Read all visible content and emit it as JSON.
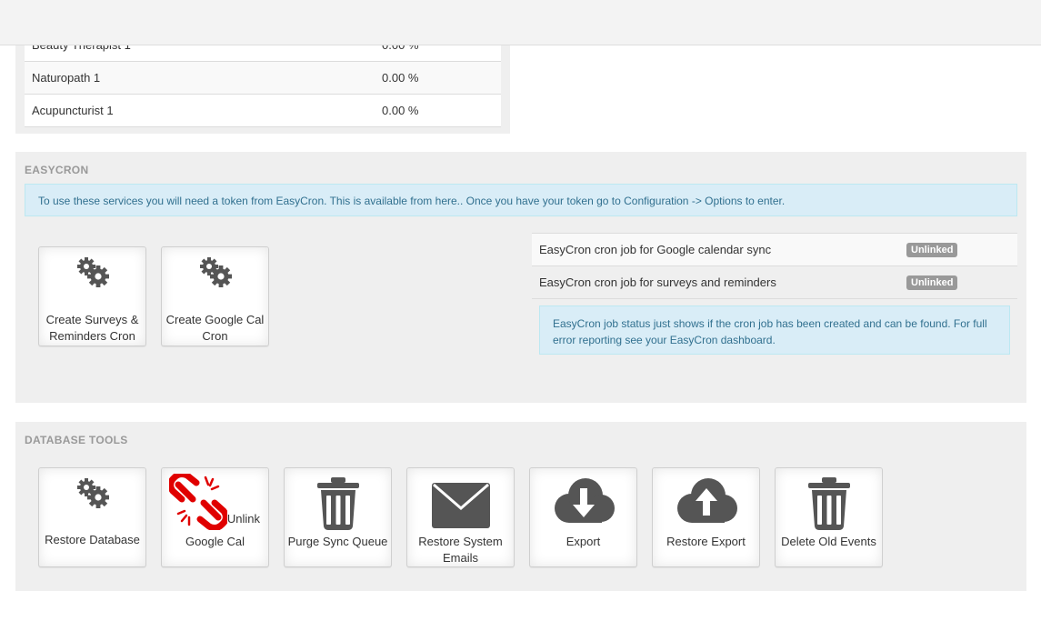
{
  "top_table": {
    "rows": [
      {
        "name": "Beauty Therapist 1",
        "value": "0.00 %"
      },
      {
        "name": "Naturopath 1",
        "value": "0.00 %"
      },
      {
        "name": "Acupuncturist 1",
        "value": "0.00 %"
      }
    ]
  },
  "easycron": {
    "title": "EASYCRON",
    "info": "To use these services you will need a token from EasyCron. This is available from here.. Once you have your token go to Configuration -> Options to enter.",
    "tiles": [
      {
        "label": "Create Surveys & Reminders Cron",
        "icon": "gears-icon"
      },
      {
        "label": "Create Google Cal Cron",
        "icon": "gears-icon"
      }
    ],
    "jobs": [
      {
        "name": "EasyCron cron job for Google calendar sync",
        "status": "Unlinked"
      },
      {
        "name": "EasyCron cron job for surveys and reminders",
        "status": "Unlinked"
      }
    ],
    "note": "EasyCron job status just shows if the cron job has been created and can be found. For full error reporting see your EasyCron dashboard."
  },
  "dbtools": {
    "title": "DATABASE TOOLS",
    "tiles": [
      {
        "label": "Restore Database",
        "icon": "gears-icon"
      },
      {
        "label": "Google Cal",
        "extra": "Unlink",
        "icon": "broken-link-icon"
      },
      {
        "label": "Purge Sync Queue",
        "icon": "trash-icon"
      },
      {
        "label": "Restore System Emails",
        "icon": "envelope-icon"
      },
      {
        "label": "Export",
        "icon": "cloud-download-icon"
      },
      {
        "label": "Restore Export",
        "icon": "cloud-upload-icon"
      },
      {
        "label": "Delete Old Events",
        "icon": "trash-icon"
      }
    ]
  },
  "colors": {
    "panel_bg": "#efefef",
    "info_bg": "#d9edf7",
    "info_text": "#31708f",
    "badge": "#999999",
    "icon": "#555555",
    "link_red": "#e00000"
  }
}
